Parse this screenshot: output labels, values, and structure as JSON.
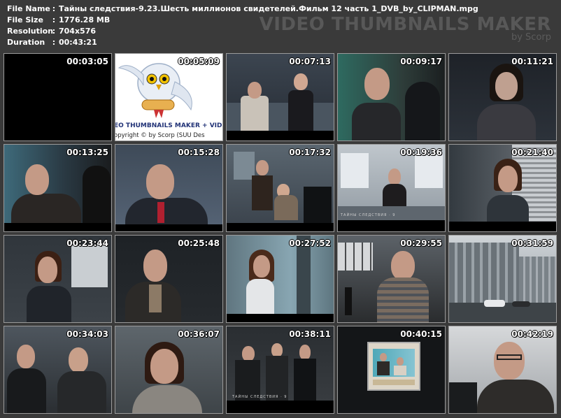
{
  "info": [
    {
      "key": "File Name",
      "sep": ":",
      "value": "Тайны следствия-9.23.Шесть миллионов свидетелей.Фильм 12 часть 1_DVB_by_CLIPMAN.mpg"
    },
    {
      "key": "File Size",
      "sep": ":",
      "value": "1776.28 MB"
    },
    {
      "key": "Resolution",
      "sep": ":",
      "value": "704x576"
    },
    {
      "key": "Duration",
      "sep": ":",
      "value": "00:43:21"
    }
  ],
  "logo": {
    "title": "VIDEO THUMBNAILS MAKER",
    "subtitle": "by Scorp"
  },
  "thumbnails": [
    {
      "time": "00:03:05"
    },
    {
      "time": "00:05:09",
      "logo_text": "EO THUMBNAILS MAKER + VID",
      "copyright": "opyright © by Scorp (SUU Des"
    },
    {
      "time": "00:07:13"
    },
    {
      "time": "00:09:17"
    },
    {
      "time": "00:11:21"
    },
    {
      "time": "00:13:25"
    },
    {
      "time": "00:15:28"
    },
    {
      "time": "00:17:32"
    },
    {
      "time": "00:19:36",
      "caption": "ТАЙНЫ СЛЕДСТВИЯ · 9"
    },
    {
      "time": "00:21:40"
    },
    {
      "time": "00:23:44"
    },
    {
      "time": "00:25:48"
    },
    {
      "time": "00:27:52"
    },
    {
      "time": "00:29:55"
    },
    {
      "time": "00:31:59"
    },
    {
      "time": "00:34:03"
    },
    {
      "time": "00:36:07"
    },
    {
      "time": "00:38:11",
      "caption": "ТАЙНЫ СЛЕДСТВИЯ · 9"
    },
    {
      "time": "00:40:15"
    },
    {
      "time": "00:42:19"
    }
  ]
}
